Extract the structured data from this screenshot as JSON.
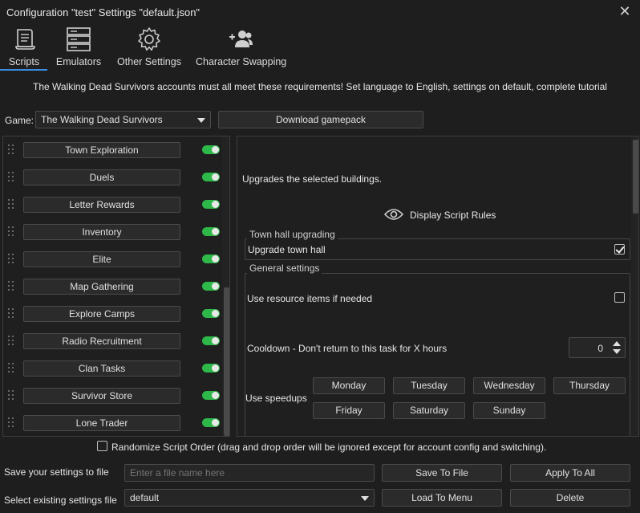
{
  "window": {
    "title": "Configuration \"test\" Settings \"default.json\""
  },
  "tabs": [
    {
      "label": "Scripts",
      "icon": "scroll-icon",
      "active": true
    },
    {
      "label": "Emulators",
      "icon": "server-icon"
    },
    {
      "label": "Other Settings",
      "icon": "gear-icon"
    },
    {
      "label": "Character Swapping",
      "icon": "user-swap-icon"
    }
  ],
  "notice": "The Walking Dead Survivors accounts must all meet these requirements! Set language to English, settings on default, complete tutorial",
  "game": {
    "label": "Game:",
    "selected": "The Walking Dead Survivors",
    "download_label": "Download gamepack"
  },
  "scripts": [
    {
      "label": "Town Exploration",
      "enabled": true
    },
    {
      "label": "Duels",
      "enabled": true
    },
    {
      "label": "Letter Rewards",
      "enabled": true
    },
    {
      "label": "Inventory",
      "enabled": true
    },
    {
      "label": "Elite",
      "enabled": true
    },
    {
      "label": "Map Gathering",
      "enabled": true
    },
    {
      "label": "Explore Camps",
      "enabled": true
    },
    {
      "label": "Radio Recruitment",
      "enabled": true
    },
    {
      "label": "Clan Tasks",
      "enabled": true
    },
    {
      "label": "Survivor Store",
      "enabled": true
    },
    {
      "label": "Lone Trader",
      "enabled": true
    }
  ],
  "detail": {
    "description": "Upgrades the selected buildings.",
    "rules_label": "Display Script Rules",
    "townhall": {
      "title": "Town hall upgrading",
      "upgrade_label": "Upgrade town hall",
      "upgrade_checked": true
    },
    "general": {
      "title": "General settings",
      "resource_label": "Use resource items if needed",
      "resource_checked": false,
      "cooldown_label": "Cooldown - Don't return to this task for X hours",
      "cooldown_value": "0",
      "speedups_label": "Use speedups",
      "days": [
        "Monday",
        "Tuesday",
        "Wednesday",
        "Thursday",
        "Friday",
        "Saturday",
        "Sunday"
      ]
    }
  },
  "randomize": {
    "label": "Randomize Script Order (drag and drop order will be ignored except for account config and switching).",
    "checked": false
  },
  "save": {
    "label": "Save your settings to file",
    "placeholder": "Enter a file name here",
    "save_button": "Save To File",
    "apply_button": "Apply To All"
  },
  "load": {
    "label": "Select existing settings file",
    "selected": "default",
    "load_button": "Load To Menu",
    "delete_button": "Delete"
  },
  "colors": {
    "accent": "#3a8ee6",
    "toggle_on": "#2fb84a",
    "background": "#1e1e1e"
  }
}
